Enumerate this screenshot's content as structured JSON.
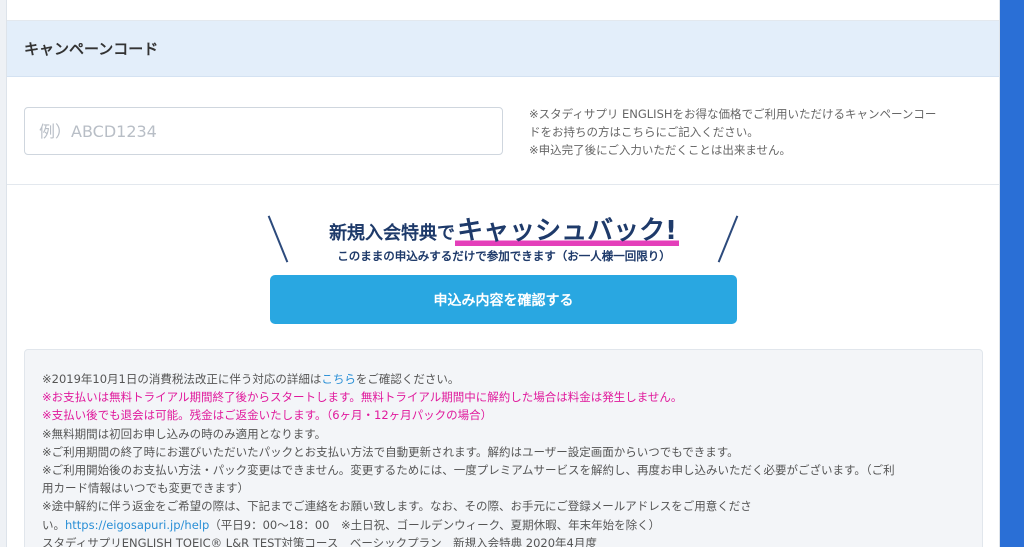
{
  "campaign": {
    "header": "キャンペーンコード",
    "placeholder": "例）ABCD1234",
    "notes": [
      "※スタディサプリ ENGLISHをお得な価格でご利用いただけるキャンペーンコー",
      "ドをお持ちの方はこちらにご記入ください。",
      "※申込完了後にご入力いただくことは出来ません。"
    ]
  },
  "cashback": {
    "prefix": "新規入会特典で",
    "highlight": "キャッシュバック!",
    "subtitle": "このままの申込みするだけで参加できます（お一人様一回限り）",
    "colors": {
      "navy": "#1e3a6a",
      "underline": "#e43fba"
    }
  },
  "confirm_button": {
    "label": "申込み内容を確認する",
    "color": "#29a7e1"
  },
  "notices": {
    "line1_pre": "※2019年10月1日の消費税法改正に伴う対応の詳細は",
    "line1_link": "こちら",
    "line1_post": "をご確認ください。",
    "line2": "※お支払いは無料トライアル期間終了後からスタートします。無料トライアル期間中に解約した場合は料金は発生しません。",
    "line3": "※支払い後でも退会は可能。残金はご返金いたします。（6ヶ月・12ヶ月パックの場合）",
    "line4": "※無料期間は初回お申し込みの時のみ適用となります。",
    "line5": "※ご利用期間の終了時にお選びいただいたパックとお支払い方法で自動更新されます。解約はユーザー設定画面からいつでもできます。",
    "line6": "※ご利用開始後のお支払い方法・パック変更はできません。変更するためには、一度プレミアムサービスを解約し、再度お申し込みいただく必要がございます。（ご利",
    "line7": "用カード情報はいつでも変更できます）",
    "line8": "※途中解約に伴う返金をご希望の際は、下記までご連絡をお願い致します。なお、その際、お手元にご登録メールアドレスをご用意くださ",
    "line9_pre": "い。",
    "line9_link": "https://eigosapuri.jp/help",
    "line9_post": "（平日9：00〜18：00　※土日祝、ゴールデンウィーク、夏期休暇、年末年始を除く）",
    "line10": "スタディサプリENGLISH TOEIC® L&R TEST対策コース　ベーシックプラン　新規入会特典 2020年4月度",
    "colors": {
      "warning": "#e0199c",
      "link": "#2a8fd6"
    }
  }
}
